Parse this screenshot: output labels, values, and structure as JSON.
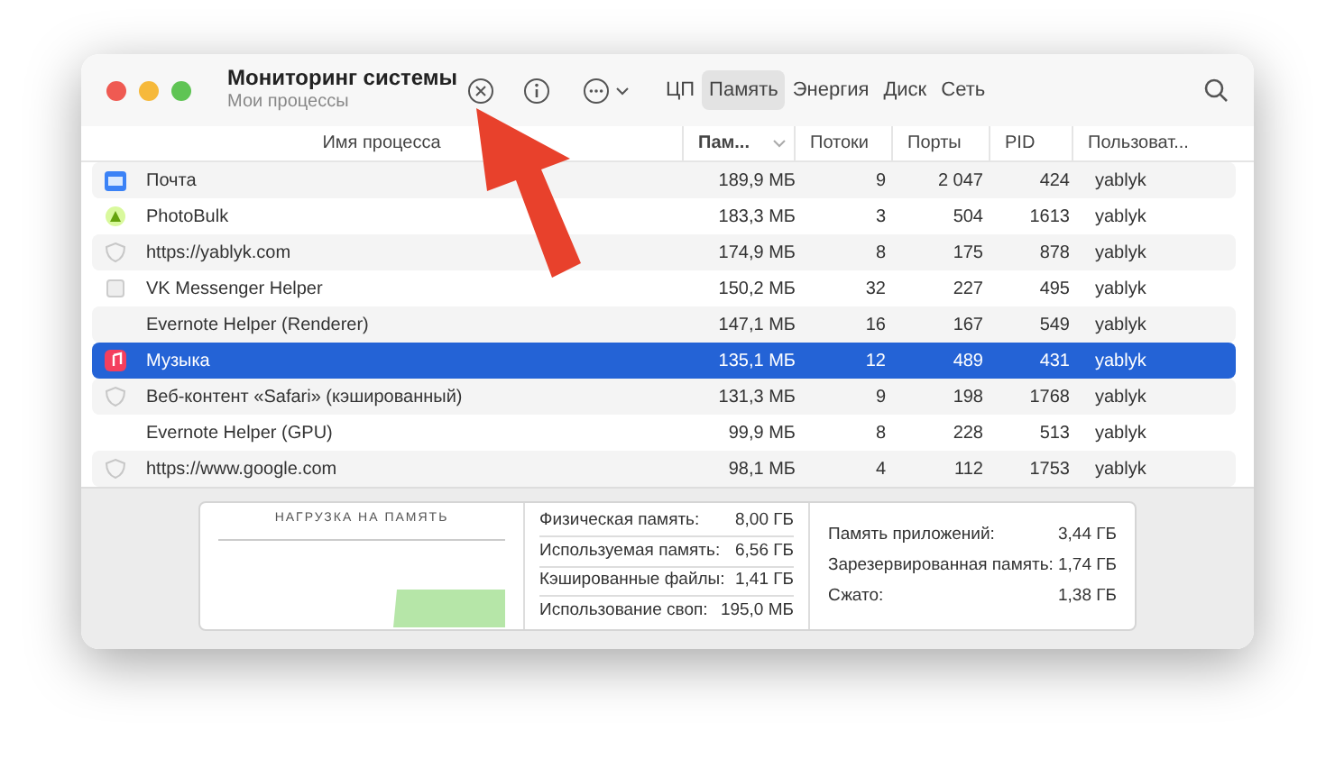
{
  "window": {
    "title": "Мониторинг системы",
    "subtitle": "Мои процессы"
  },
  "tabs": [
    {
      "label": "ЦП",
      "selected": false
    },
    {
      "label": "Память",
      "selected": true
    },
    {
      "label": "Энергия",
      "selected": false
    },
    {
      "label": "Диск",
      "selected": false
    },
    {
      "label": "Сеть",
      "selected": false
    }
  ],
  "table": {
    "columns": [
      {
        "label": "Имя процесса",
        "sorted": false
      },
      {
        "label": "Пам...",
        "sorted": true
      },
      {
        "label": "Потоки",
        "sorted": false
      },
      {
        "label": "Порты",
        "sorted": false
      },
      {
        "label": "PID",
        "sorted": false
      },
      {
        "label": "Пользоват...",
        "sorted": false
      }
    ],
    "rows": [
      {
        "kind": "mail",
        "name": "Почта",
        "memory": "189,9 МБ",
        "threads": "9",
        "ports": "2 047",
        "pid": "424",
        "user": "yablyk",
        "selected": false
      },
      {
        "kind": "app",
        "name": "PhotoBulk",
        "memory": "183,3 МБ",
        "threads": "3",
        "ports": "504",
        "pid": "1613",
        "user": "yablyk",
        "selected": false
      },
      {
        "kind": "shield",
        "name": "https://yablyk.com",
        "memory": "174,9 МБ",
        "threads": "8",
        "ports": "175",
        "pid": "878",
        "user": "yablyk",
        "selected": false
      },
      {
        "kind": "helper",
        "name": "VK Messenger Helper",
        "memory": "150,2 МБ",
        "threads": "32",
        "ports": "227",
        "pid": "495",
        "user": "yablyk",
        "selected": false
      },
      {
        "kind": "none",
        "name": "Evernote Helper (Renderer)",
        "memory": "147,1 МБ",
        "threads": "16",
        "ports": "167",
        "pid": "549",
        "user": "yablyk",
        "selected": false
      },
      {
        "kind": "music",
        "name": "Музыка",
        "memory": "135,1 МБ",
        "threads": "12",
        "ports": "489",
        "pid": "431",
        "user": "yablyk",
        "selected": true
      },
      {
        "kind": "shield",
        "name": "Веб-контент «Safari» (кэшированный)",
        "memory": "131,3 МБ",
        "threads": "9",
        "ports": "198",
        "pid": "1768",
        "user": "yablyk",
        "selected": false
      },
      {
        "kind": "none",
        "name": "Evernote Helper (GPU)",
        "memory": "99,9 МБ",
        "threads": "8",
        "ports": "228",
        "pid": "513",
        "user": "yablyk",
        "selected": false
      },
      {
        "kind": "shield",
        "name": "https://www.google.com",
        "memory": "98,1 МБ",
        "threads": "4",
        "ports": "112",
        "pid": "1753",
        "user": "yablyk",
        "selected": false
      }
    ]
  },
  "memory_pressure": {
    "title": "НАГРУЗКА НА ПАМЯТЬ"
  },
  "stats_left": [
    {
      "label": "Физическая память:",
      "value": "8,00 ГБ"
    },
    {
      "label": "Используемая память:",
      "value": "6,56 ГБ"
    },
    {
      "label": "Кэшированные файлы:",
      "value": "1,41 ГБ"
    },
    {
      "label": "Использование своп:",
      "value": "195,0 МБ"
    }
  ],
  "stats_right": [
    {
      "label": "Память приложений:",
      "value": "3,44 ГБ"
    },
    {
      "label": "Зарезервированная память:",
      "value": "1,74 ГБ"
    },
    {
      "label": "Сжато:",
      "value": "1,38 ГБ"
    }
  ]
}
